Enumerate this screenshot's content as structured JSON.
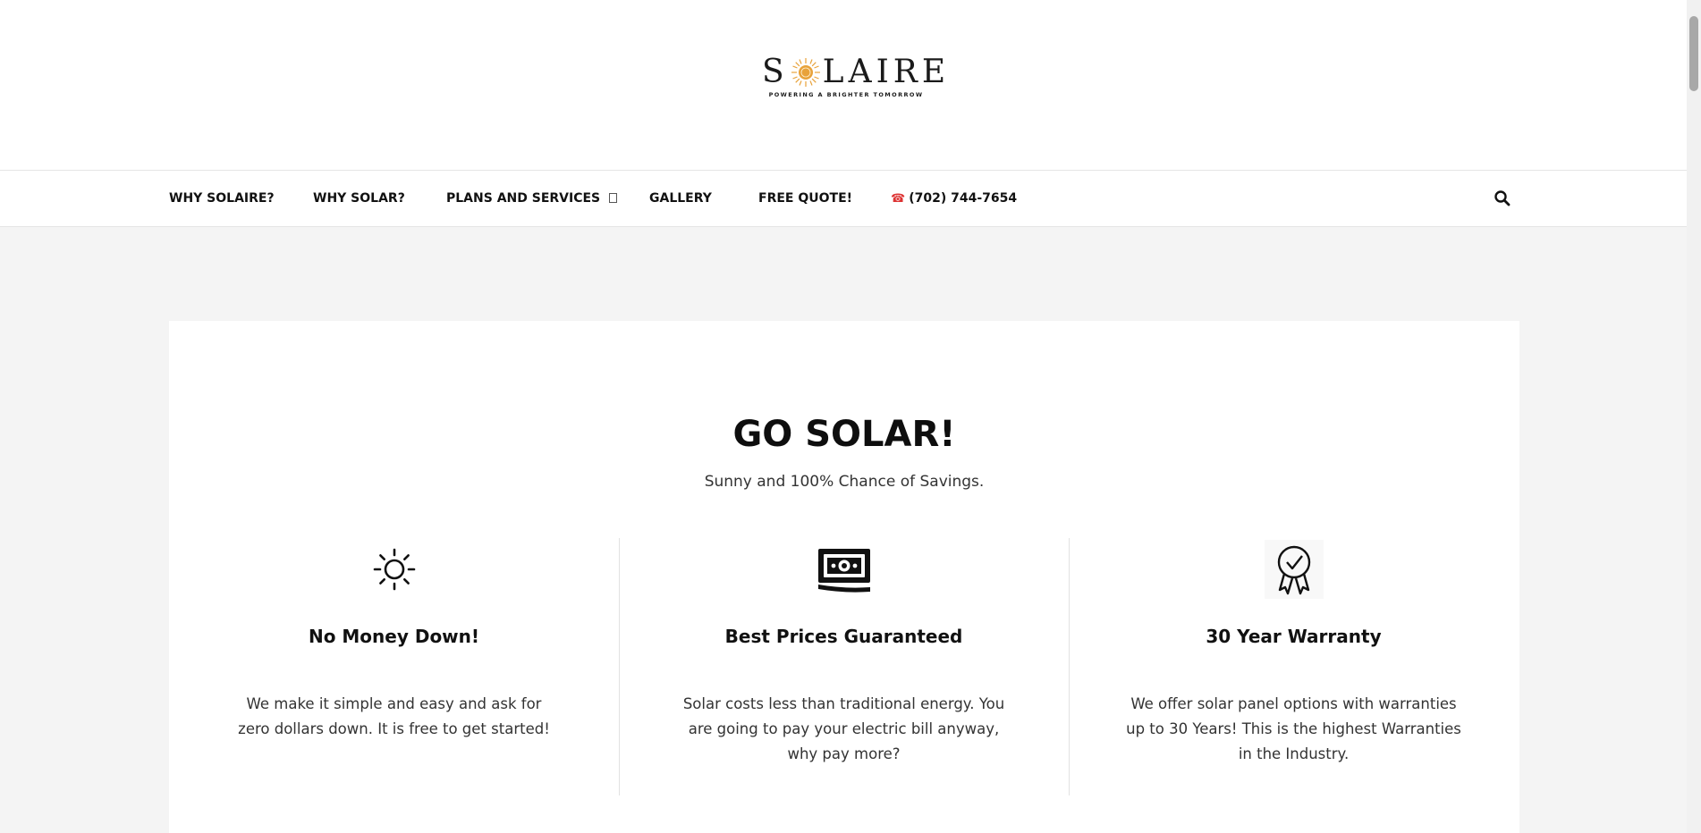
{
  "header": {
    "logo_left": "S",
    "logo_right": "LAIRE",
    "tagline": "POWERING A BRIGHTER TOMORROW"
  },
  "nav": {
    "items": [
      {
        "label": "WHY SOLAIRE?"
      },
      {
        "label": "WHY SOLAR?"
      },
      {
        "label": "PLANS AND SERVICES"
      },
      {
        "label": "GALLERY"
      },
      {
        "label": "FREE QUOTE!"
      }
    ],
    "phone_icon": "☎",
    "phone": "(702) 744-7654",
    "search_icon": "search-icon"
  },
  "main": {
    "title": "GO SOLAR!",
    "subtitle": "Sunny and 100% Chance of Savings.",
    "features": [
      {
        "icon": "sun-icon",
        "title": "No Money Down!",
        "text": "We make it simple and easy and ask for zero dollars down. It is free to get started!"
      },
      {
        "icon": "money-icon",
        "title": "Best Prices Guaranteed",
        "text": "Solar costs less than traditional energy. You are going to pay your electric bill anyway, why pay more?"
      },
      {
        "icon": "award-ribbon-icon",
        "title": "30 Year Warranty",
        "text": "We offer solar panel options with warranties up to 30 Years! This is the highest Warranties in the Industry."
      }
    ]
  },
  "colors": {
    "accent_sun": "#e8a23a",
    "phone_icon": "#dd3333",
    "background": "#f4f4f4"
  }
}
